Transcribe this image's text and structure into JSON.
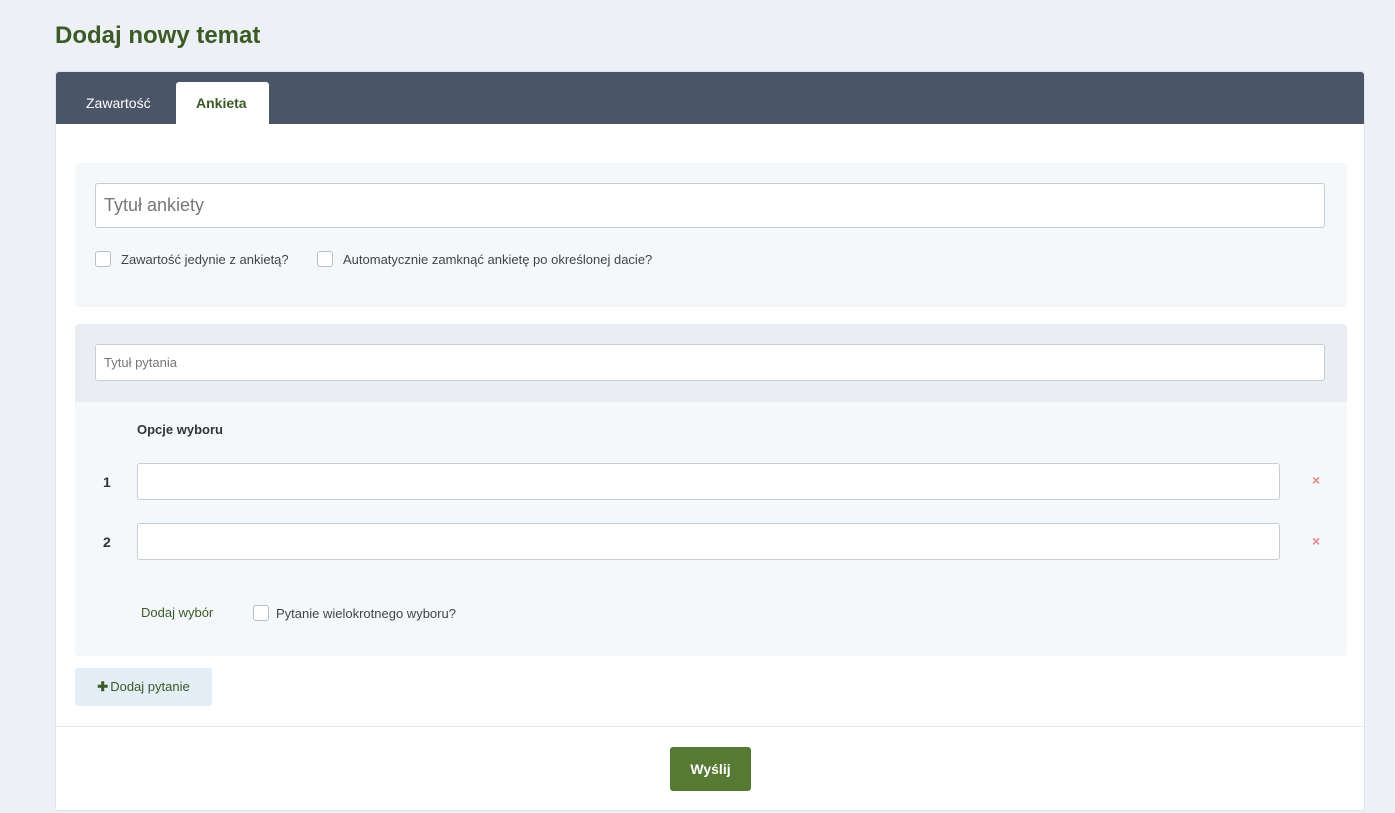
{
  "page": {
    "title": "Dodaj nowy temat"
  },
  "tabs": [
    {
      "label": "Zawartość",
      "active": false
    },
    {
      "label": "Ankieta",
      "active": true
    }
  ],
  "poll": {
    "title_placeholder": "Tytuł ankiety",
    "only_poll_label": "Zawartość jedynie z ankietą?",
    "auto_close_label": "Automatycznie zamknąć ankietę po określonej dacie?"
  },
  "question": {
    "title_placeholder": "Tytuł pytania",
    "options_heading": "Opcje wyboru",
    "options": [
      {
        "number": "1",
        "value": "",
        "remove_icon": "×"
      },
      {
        "number": "2",
        "value": "",
        "remove_icon": "×"
      }
    ],
    "add_choice_label": "Dodaj wybór",
    "multiple_choice_label": "Pytanie wielokrotnego wyboru?"
  },
  "actions": {
    "add_question_icon": "✚",
    "add_question_label": "Dodaj pytanie",
    "submit_label": "Wyślij"
  },
  "colors": {
    "accent": "#3b5a26",
    "submit": "#567a34",
    "tabbar": "#4a5568",
    "remove": "#e08a8a"
  }
}
